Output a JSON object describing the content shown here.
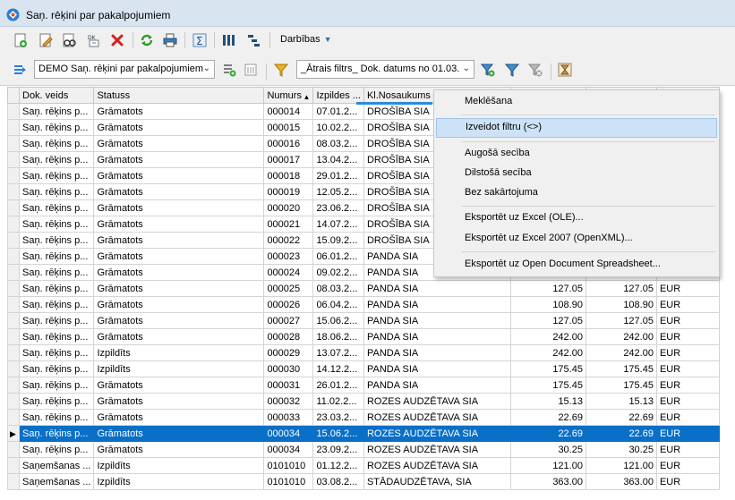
{
  "window": {
    "title": "Saņ. rēķini par pakalpojumiem"
  },
  "toolbar": {
    "actions_label": "Darbības"
  },
  "toolbar2": {
    "doc_type_value": "DEMO Saņ. rēķini par pakalpojumiem",
    "filter_value": "_Ātrais filtrs_ Dok. datums no 01.03."
  },
  "grid": {
    "columns": [
      "Dok. veids",
      "Statuss",
      "Numurs",
      "Izpildes ...",
      "Kl.Nosaukums"
    ],
    "rows": [
      {
        "type": "Saņ. rēķins p...",
        "status": "Grāmatots",
        "num": "000014",
        "date": "07.01.2...",
        "client": "DROŠĪBA SIA",
        "sum1": "",
        "sum2": "",
        "cur": ""
      },
      {
        "type": "Saņ. rēķins p...",
        "status": "Grāmatots",
        "num": "000015",
        "date": "10.02.2...",
        "client": "DROŠĪBA SIA",
        "sum1": "",
        "sum2": "",
        "cur": ""
      },
      {
        "type": "Saņ. rēķins p...",
        "status": "Grāmatots",
        "num": "000016",
        "date": "08.03.2...",
        "client": "DROŠĪBA SIA",
        "sum1": "",
        "sum2": "",
        "cur": ""
      },
      {
        "type": "Saņ. rēķins p...",
        "status": "Grāmatots",
        "num": "000017",
        "date": "13.04.2...",
        "client": "DROŠĪBA SIA",
        "sum1": "",
        "sum2": "",
        "cur": ""
      },
      {
        "type": "Saņ. rēķins p...",
        "status": "Grāmatots",
        "num": "000018",
        "date": "29.01.2...",
        "client": "DROŠĪBA SIA",
        "sum1": "",
        "sum2": "",
        "cur": ""
      },
      {
        "type": "Saņ. rēķins p...",
        "status": "Grāmatots",
        "num": "000019",
        "date": "12.05.2...",
        "client": "DROŠĪBA SIA",
        "sum1": "",
        "sum2": "",
        "cur": ""
      },
      {
        "type": "Saņ. rēķins p...",
        "status": "Grāmatots",
        "num": "000020",
        "date": "23.06.2...",
        "client": "DROŠĪBA SIA",
        "sum1": "",
        "sum2": "",
        "cur": ""
      },
      {
        "type": "Saņ. rēķins p...",
        "status": "Grāmatots",
        "num": "000021",
        "date": "14.07.2...",
        "client": "DROŠĪBA SIA",
        "sum1": "",
        "sum2": "",
        "cur": ""
      },
      {
        "type": "Saņ. rēķins p...",
        "status": "Grāmatots",
        "num": "000022",
        "date": "15.09.2...",
        "client": "DROŠĪBA SIA",
        "sum1": "",
        "sum2": "",
        "cur": ""
      },
      {
        "type": "Saņ. rēķins p...",
        "status": "Grāmatots",
        "num": "000023",
        "date": "06.01.2...",
        "client": "PANDA SIA",
        "sum1": "",
        "sum2": "",
        "cur": ""
      },
      {
        "type": "Saņ. rēķins p...",
        "status": "Grāmatots",
        "num": "000024",
        "date": "09.02.2...",
        "client": "PANDA SIA",
        "sum1": "",
        "sum2": "",
        "cur": ""
      },
      {
        "type": "Saņ. rēķins p...",
        "status": "Grāmatots",
        "num": "000025",
        "date": "08.03.2...",
        "client": "PANDA SIA",
        "sum1": "127.05",
        "sum2": "127.05",
        "cur": "EUR"
      },
      {
        "type": "Saņ. rēķins p...",
        "status": "Grāmatots",
        "num": "000026",
        "date": "06.04.2...",
        "client": "PANDA SIA",
        "sum1": "108.90",
        "sum2": "108.90",
        "cur": "EUR"
      },
      {
        "type": "Saņ. rēķins p...",
        "status": "Grāmatots",
        "num": "000027",
        "date": "15.06.2...",
        "client": "PANDA SIA",
        "sum1": "127.05",
        "sum2": "127.05",
        "cur": "EUR"
      },
      {
        "type": "Saņ. rēķins p...",
        "status": "Grāmatots",
        "num": "000028",
        "date": "18.06.2...",
        "client": "PANDA SIA",
        "sum1": "242.00",
        "sum2": "242.00",
        "cur": "EUR"
      },
      {
        "type": "Saņ. rēķins p...",
        "status": "Izpildīts",
        "num": "000029",
        "date": "13.07.2...",
        "client": "PANDA SIA",
        "sum1": "242.00",
        "sum2": "242.00",
        "cur": "EUR"
      },
      {
        "type": "Saņ. rēķins p...",
        "status": "Izpildīts",
        "num": "000030",
        "date": "14.12.2...",
        "client": "PANDA SIA",
        "sum1": "175.45",
        "sum2": "175.45",
        "cur": "EUR"
      },
      {
        "type": "Saņ. rēķins p...",
        "status": "Grāmatots",
        "num": "000031",
        "date": "26.01.2...",
        "client": "PANDA SIA",
        "sum1": "175.45",
        "sum2": "175.45",
        "cur": "EUR"
      },
      {
        "type": "Saņ. rēķins p...",
        "status": "Grāmatots",
        "num": "000032",
        "date": "11.02.2...",
        "client": "ROZES AUDZĒTAVA SIA",
        "sum1": "15.13",
        "sum2": "15.13",
        "cur": "EUR"
      },
      {
        "type": "Saņ. rēķins p...",
        "status": "Grāmatots",
        "num": "000033",
        "date": "23.03.2...",
        "client": "ROZES AUDZĒTAVA SIA",
        "sum1": "22.69",
        "sum2": "22.69",
        "cur": "EUR"
      },
      {
        "type": "Saņ. rēķins p...",
        "status": "Grāmatots",
        "num": "000034",
        "date": "15.06.2...",
        "client": "ROZES AUDZĒTAVA SIA",
        "sum1": "22.69",
        "sum2": "22.69",
        "cur": "EUR",
        "selected": true
      },
      {
        "type": "Saņ. rēķins p...",
        "status": "Grāmatots",
        "num": "000034",
        "date": "23.09.2...",
        "client": "ROZES AUDZĒTAVA SIA",
        "sum1": "30.25",
        "sum2": "30.25",
        "cur": "EUR"
      },
      {
        "type": "Saņemšanas ...",
        "status": "Izpildīts",
        "num": "0101010",
        "date": "01.12.2...",
        "client": "ROZES AUDZĒTAVA SIA",
        "sum1": "121.00",
        "sum2": "121.00",
        "cur": "EUR"
      },
      {
        "type": "Saņemšanas ...",
        "status": "Izpildīts",
        "num": "0101010",
        "date": "03.08.2...",
        "client": "STĀDAUDZĒTAVA, SIA",
        "sum1": "363.00",
        "sum2": "363.00",
        "cur": "EUR"
      }
    ]
  },
  "context_menu": {
    "items": [
      "Meklēšana",
      "Izveidot filtru (<>)",
      "Augošā secība",
      "Dilstošā secība",
      "Bez sakārtojuma",
      "Eksportēt uz Excel (OLE)...",
      "Eksportēt uz Excel 2007 (OpenXML)...",
      "Eksportēt uz Open Document Spreadsheet..."
    ],
    "highlighted_index": 1
  },
  "colors": {
    "selection": "#0a6fc6",
    "menu_highlight": "#cde2f7",
    "title_bar": "#d9e4f1"
  }
}
